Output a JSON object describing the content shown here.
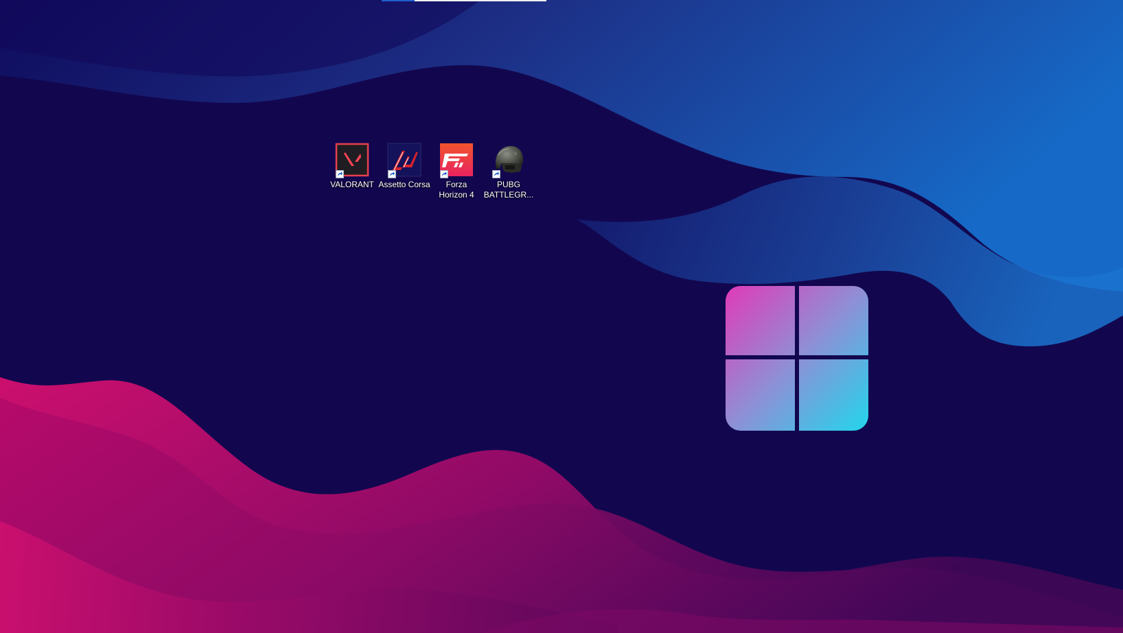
{
  "desktop": {
    "icons": [
      {
        "label": "VALORANT",
        "icon": "valorant-icon"
      },
      {
        "label": "Assetto Corsa",
        "icon": "assetto-corsa-icon"
      },
      {
        "label": "Forza\nHorizon 4",
        "icon": "forza-horizon-icon"
      },
      {
        "label": "PUBG\nBATTLEGR...",
        "icon": "pubg-helmet-icon"
      }
    ],
    "wallpaper": {
      "description_colors": {
        "base": "#12074f",
        "blue_wave": "#1a5bc0",
        "pink_wave": "#c8106a",
        "logo_top": "#d93ebd",
        "logo_bottom": "#2ed3ec"
      }
    }
  }
}
